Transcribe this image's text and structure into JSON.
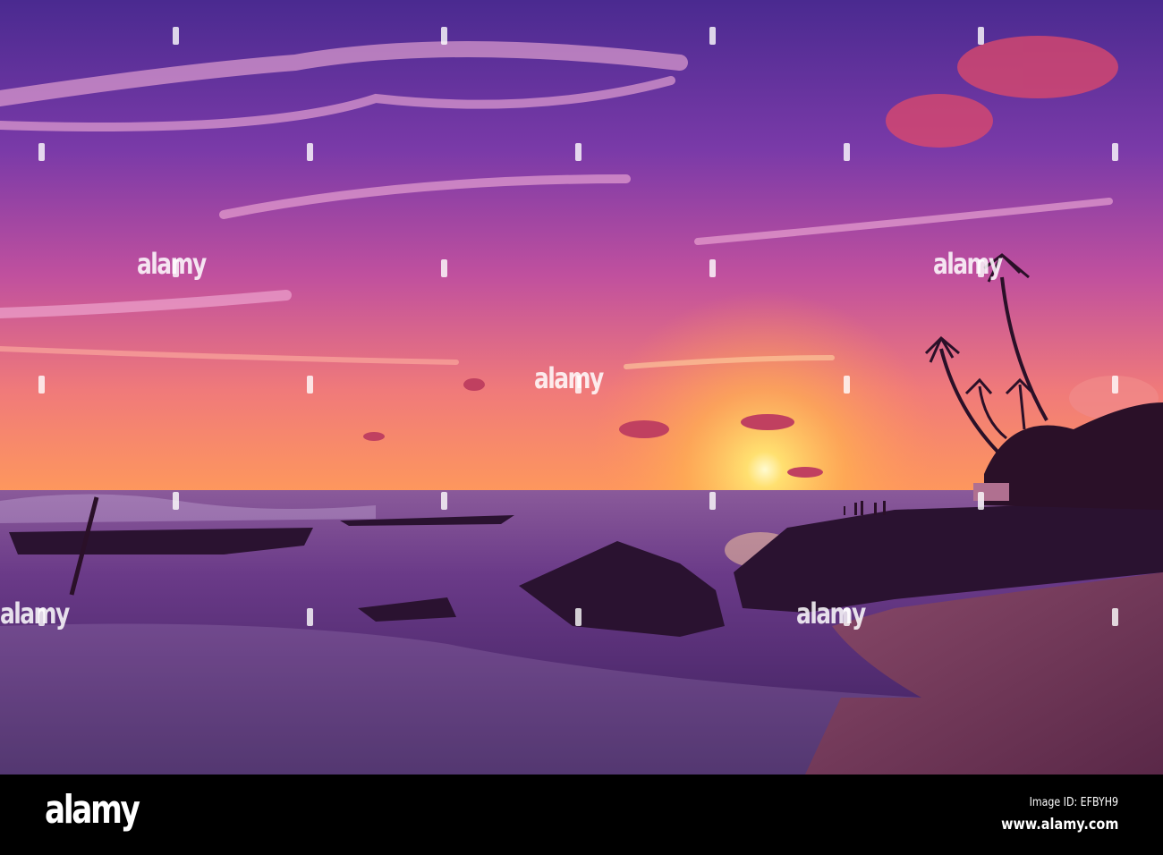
{
  "photo": {
    "subject": "tropical beach sunset",
    "watermark_text": "alamy",
    "colors": {
      "sky_top": "#5a2a9a",
      "sky_mid": "#c04a9a",
      "horizon": "#ff8a50",
      "sun": "#fff6c0",
      "sea": "#4a2a6a",
      "sand": "#7a3a5a"
    }
  },
  "footer": {
    "logo": "alamy",
    "image_id": "Image ID: EFBYH9",
    "website": "www.alamy.com"
  }
}
